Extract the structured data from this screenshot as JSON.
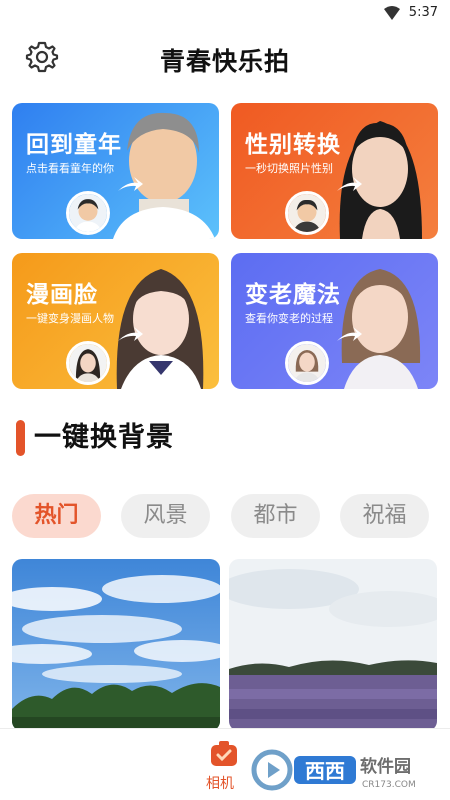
{
  "status_bar": {
    "time": "5:37",
    "wifi_icon": "wifi-icon"
  },
  "header": {
    "title": "青春快乐拍",
    "settings_icon": "gear-icon"
  },
  "features": [
    {
      "title": "回到童年",
      "subtitle": "点击看看童年的你",
      "color": "#2f7ff0"
    },
    {
      "title": "性别转换",
      "subtitle": "一秒切换照片性别",
      "color": "#f05a22"
    },
    {
      "title": "漫画脸",
      "subtitle": "一键变身漫画人物",
      "color": "#f59a1a"
    },
    {
      "title": "变老魔法",
      "subtitle": "查看你变老的过程",
      "color": "#5c6df2"
    }
  ],
  "section": {
    "title": "一键换背景",
    "accent": "#e3542a"
  },
  "categories": [
    {
      "label": "热门",
      "active": true
    },
    {
      "label": "风景",
      "active": false
    },
    {
      "label": "都市",
      "active": false
    },
    {
      "label": "祝福",
      "active": false
    }
  ],
  "thumbnails": [
    {
      "subject": "blue-sky-forest"
    },
    {
      "subject": "lavender-field"
    }
  ],
  "bottom_nav": {
    "camera_label": "相机",
    "camera_icon": "camera-icon",
    "accent": "#e3542a"
  },
  "watermark": {
    "text": "西西软件园",
    "domain": "CR173.COM"
  }
}
